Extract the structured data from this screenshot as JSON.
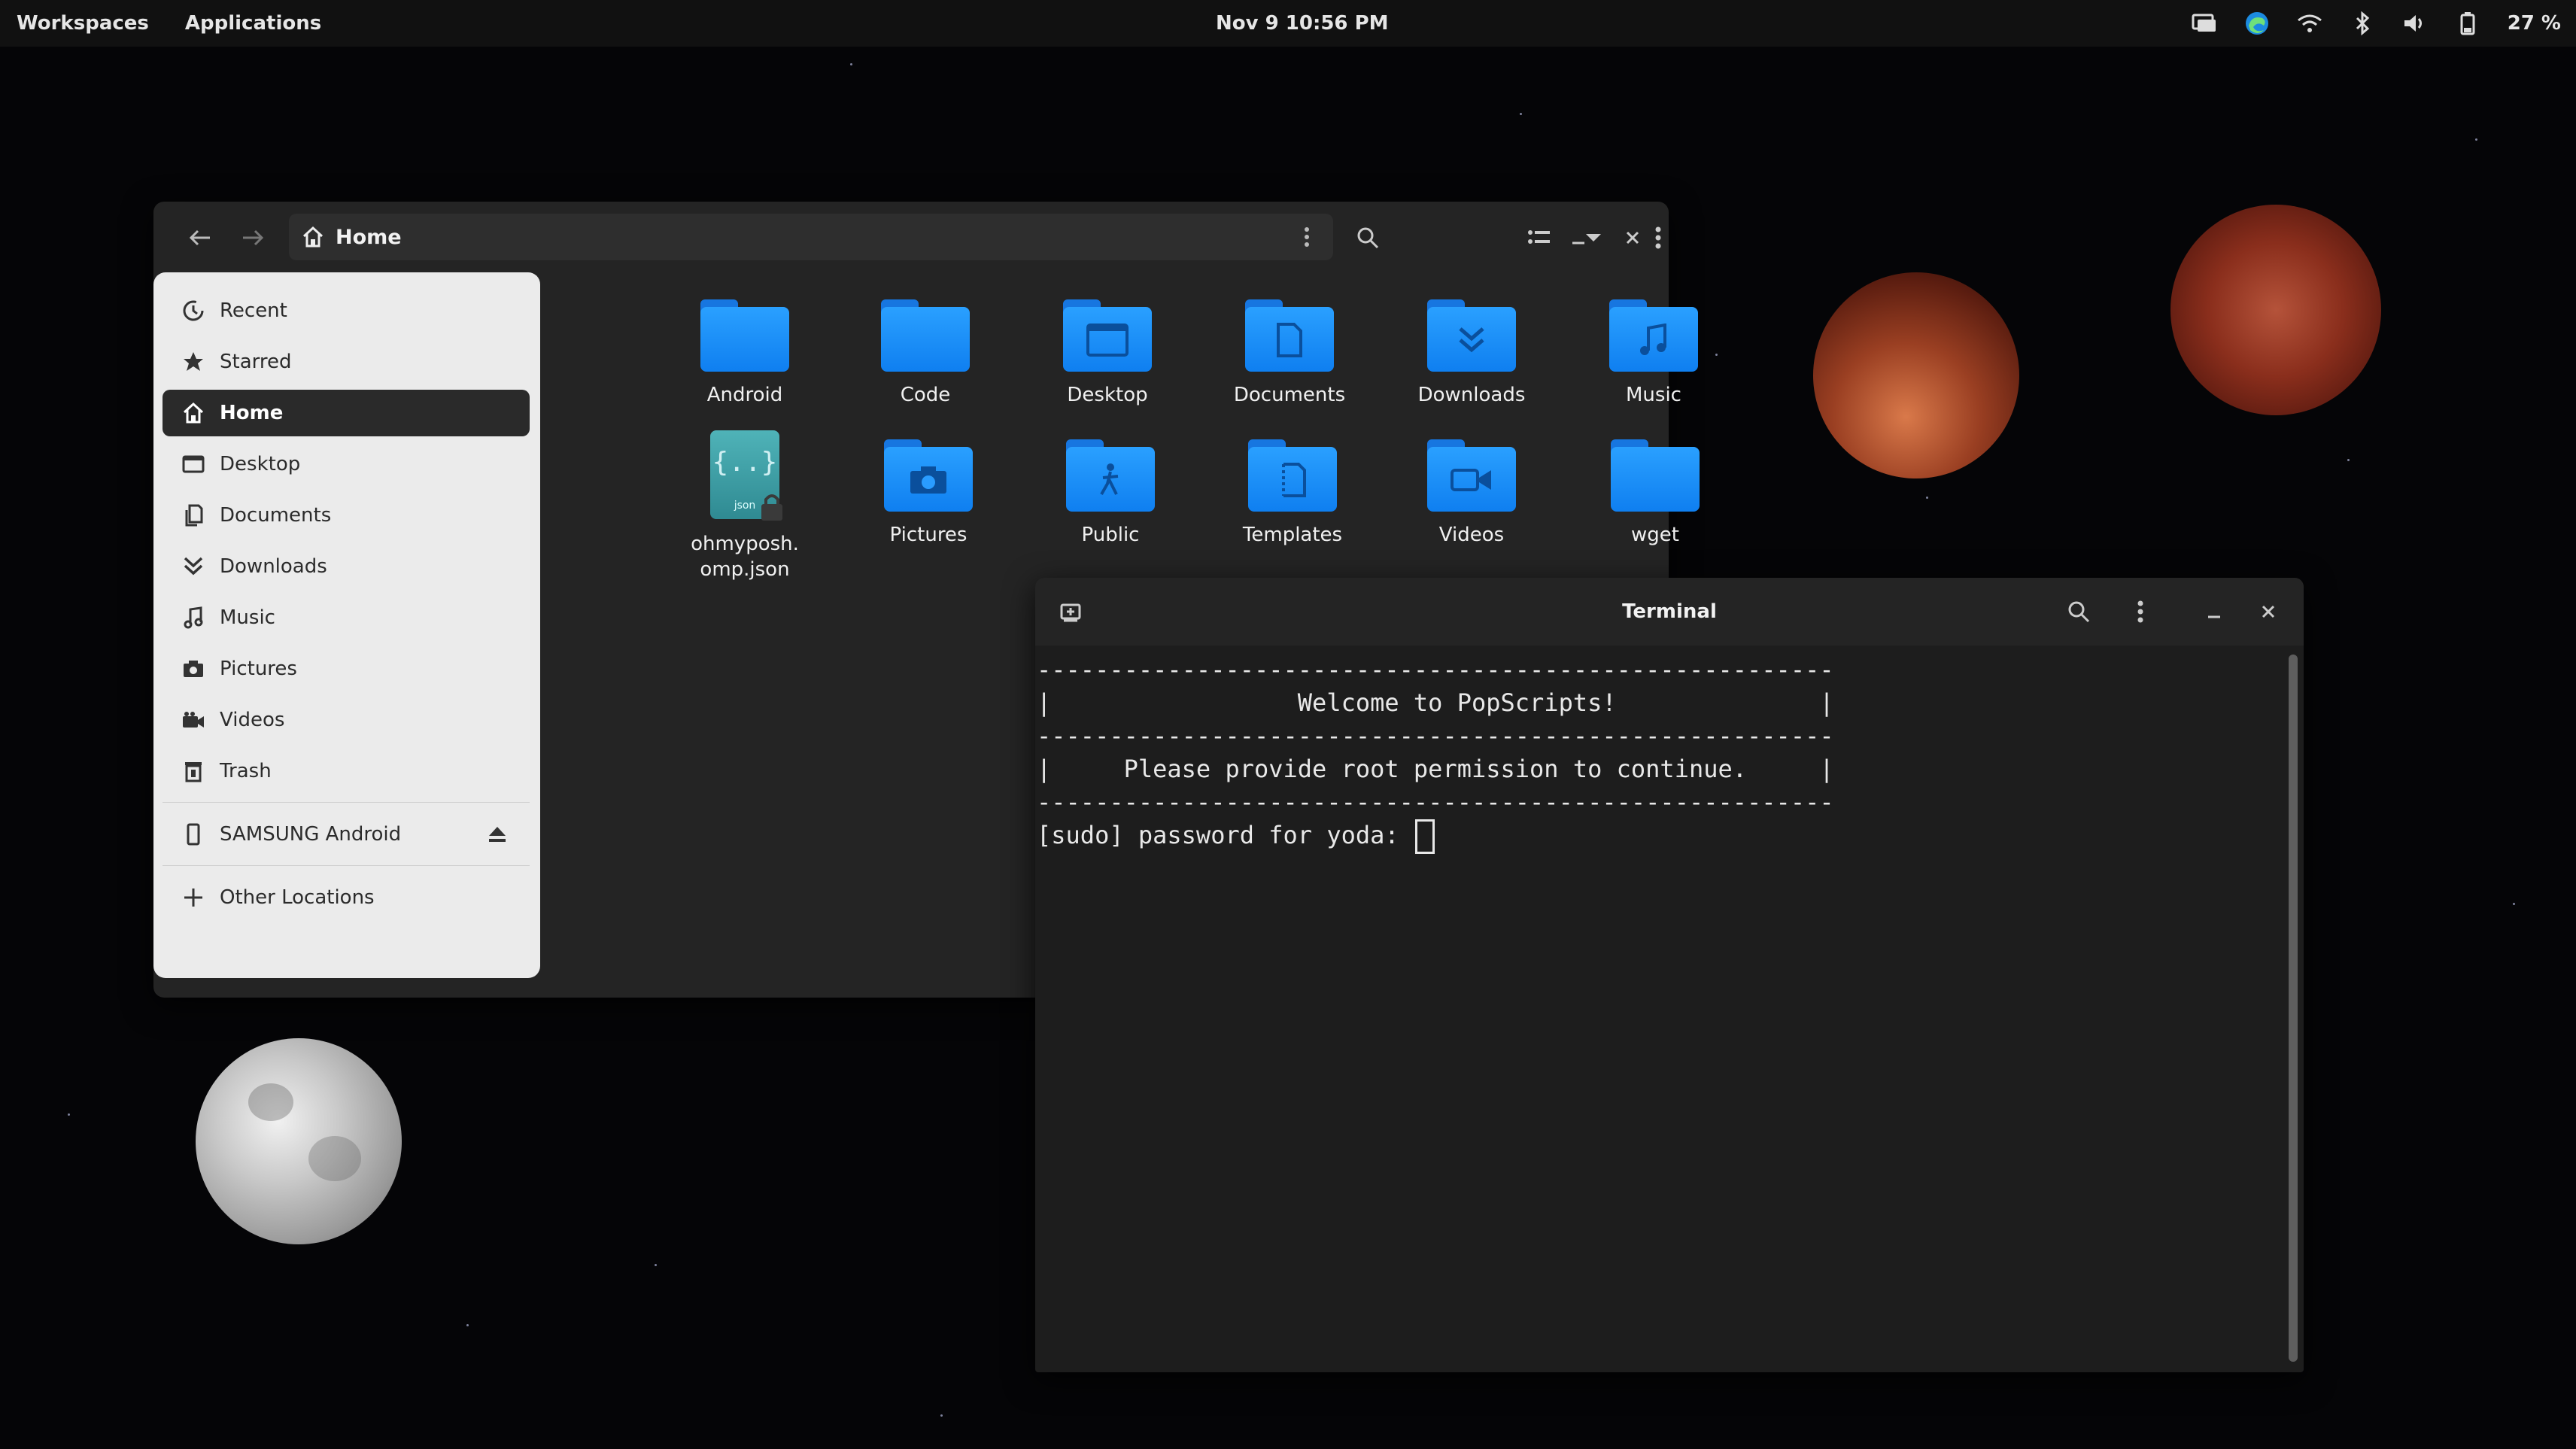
{
  "topbar": {
    "workspaces": "Workspaces",
    "applications": "Applications",
    "clock": "Nov 9  10:56 PM",
    "battery": "27 %"
  },
  "files": {
    "path_label": "Home",
    "sidebar": {
      "recent": "Recent",
      "starred": "Starred",
      "home": "Home",
      "desktop": "Desktop",
      "documents": "Documents",
      "downloads": "Downloads",
      "music": "Music",
      "pictures": "Pictures",
      "videos": "Videos",
      "trash": "Trash",
      "device": "SAMSUNG Android",
      "other_locations": "Other Locations"
    },
    "items": {
      "android": "Android",
      "code": "Code",
      "desktop": "Desktop",
      "documents": "Documents",
      "downloads": "Downloads",
      "music": "Music",
      "ohmyposh_line1": "ohmyposh.",
      "ohmyposh_line2": "omp.json",
      "ohmyposh_tag": "json",
      "pictures": "Pictures",
      "public": "Public",
      "templates": "Templates",
      "videos": "Videos",
      "wget": "wget"
    }
  },
  "terminal": {
    "title": "Terminal",
    "lines": [
      "-------------------------------------------------------",
      "|                 Welcome to PopScripts!              |",
      "-------------------------------------------------------",
      "|     Please provide root permission to continue.     |",
      "-------------------------------------------------------",
      "[sudo] password for yoda: "
    ]
  },
  "colors": {
    "folder": "#1a8cff",
    "topbar": "#111111",
    "sidebar": "#ebebeb",
    "terminal_bg": "#1d1d1d"
  }
}
